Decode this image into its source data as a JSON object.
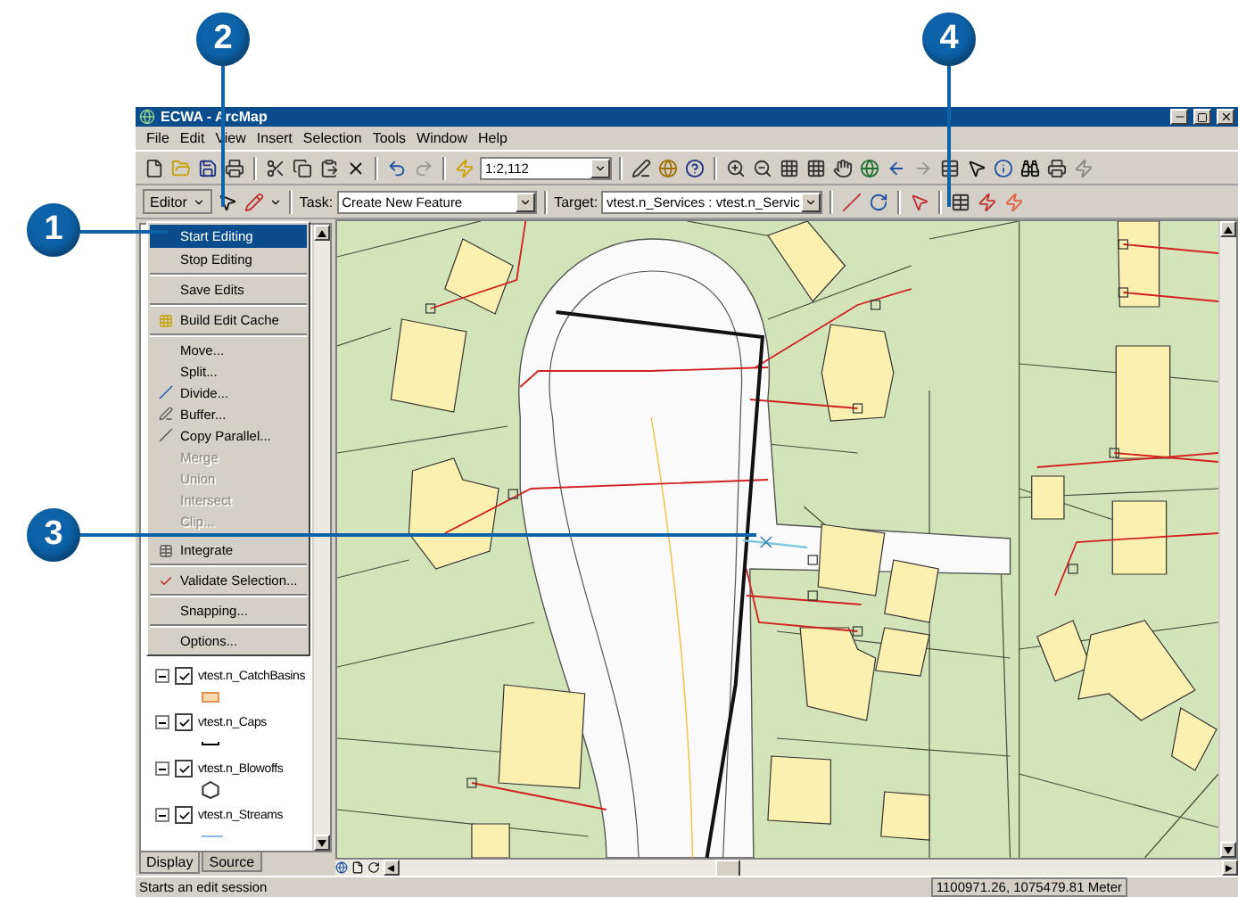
{
  "window": {
    "title": "ECWA - ArcMap"
  },
  "menu_bar": [
    "File",
    "Edit",
    "View",
    "Insert",
    "Selection",
    "Tools",
    "Window",
    "Help"
  ],
  "standard_toolbar": {
    "scale": "1:2,112"
  },
  "editor_toolbar": {
    "editor_menu": "Editor",
    "task_label": "Task:",
    "task": "Create New Feature",
    "target_label": "Target:",
    "target": "vtest.n_Services : vtest.n_Servic"
  },
  "editor_menu": {
    "groups": [
      [
        {
          "label": "Start Editing",
          "selected": true,
          "disabled": false
        },
        {
          "label": "Stop Editing",
          "selected": false,
          "disabled": false
        }
      ],
      [
        {
          "label": "Save Edits",
          "selected": false,
          "disabled": false
        }
      ],
      [
        {
          "label": "Build Edit Cache",
          "selected": false,
          "disabled": false
        }
      ],
      [
        {
          "label": "Move...",
          "selected": false,
          "disabled": false
        },
        {
          "label": "Split...",
          "selected": false,
          "disabled": false
        },
        {
          "label": "Divide...",
          "selected": false,
          "disabled": false
        },
        {
          "label": "Buffer...",
          "selected": false,
          "disabled": false
        },
        {
          "label": "Copy Parallel...",
          "selected": false,
          "disabled": false
        },
        {
          "label": "Merge",
          "selected": false,
          "disabled": true
        },
        {
          "label": "Union",
          "selected": false,
          "disabled": true
        },
        {
          "label": "Intersect",
          "selected": false,
          "disabled": true
        },
        {
          "label": "Clip...",
          "selected": false,
          "disabled": true
        }
      ],
      [
        {
          "label": "Integrate",
          "selected": false,
          "disabled": false
        }
      ],
      [
        {
          "label": "Validate Selection...",
          "selected": false,
          "disabled": false
        }
      ],
      [
        {
          "label": "Snapping...",
          "selected": false,
          "disabled": false
        }
      ],
      [
        {
          "label": "Options...",
          "selected": false,
          "disabled": false
        }
      ]
    ]
  },
  "toc": {
    "layers": [
      {
        "name": "vtest.n_CatchBasins",
        "checked": true,
        "expanded": true,
        "kind": "grid"
      },
      {
        "name": "vtest.n_Caps",
        "checked": true,
        "expanded": true,
        "kind": "tick"
      },
      {
        "name": "vtest.n_Blowoffs",
        "checked": true,
        "expanded": true,
        "kind": "hexagon"
      },
      {
        "name": "vtest.n_Streams",
        "checked": true,
        "expanded": true,
        "kind": "stream"
      }
    ],
    "tabs": [
      {
        "label": "Display",
        "selected": true
      },
      {
        "label": "Source",
        "selected": false
      }
    ]
  },
  "status_bar": {
    "message": "Starts an edit session",
    "coordinates": "1100971.26, 1075479.81 Meter"
  },
  "callouts": [
    {
      "label": "1"
    },
    {
      "label": "2"
    },
    {
      "label": "3"
    },
    {
      "label": "4"
    }
  ]
}
